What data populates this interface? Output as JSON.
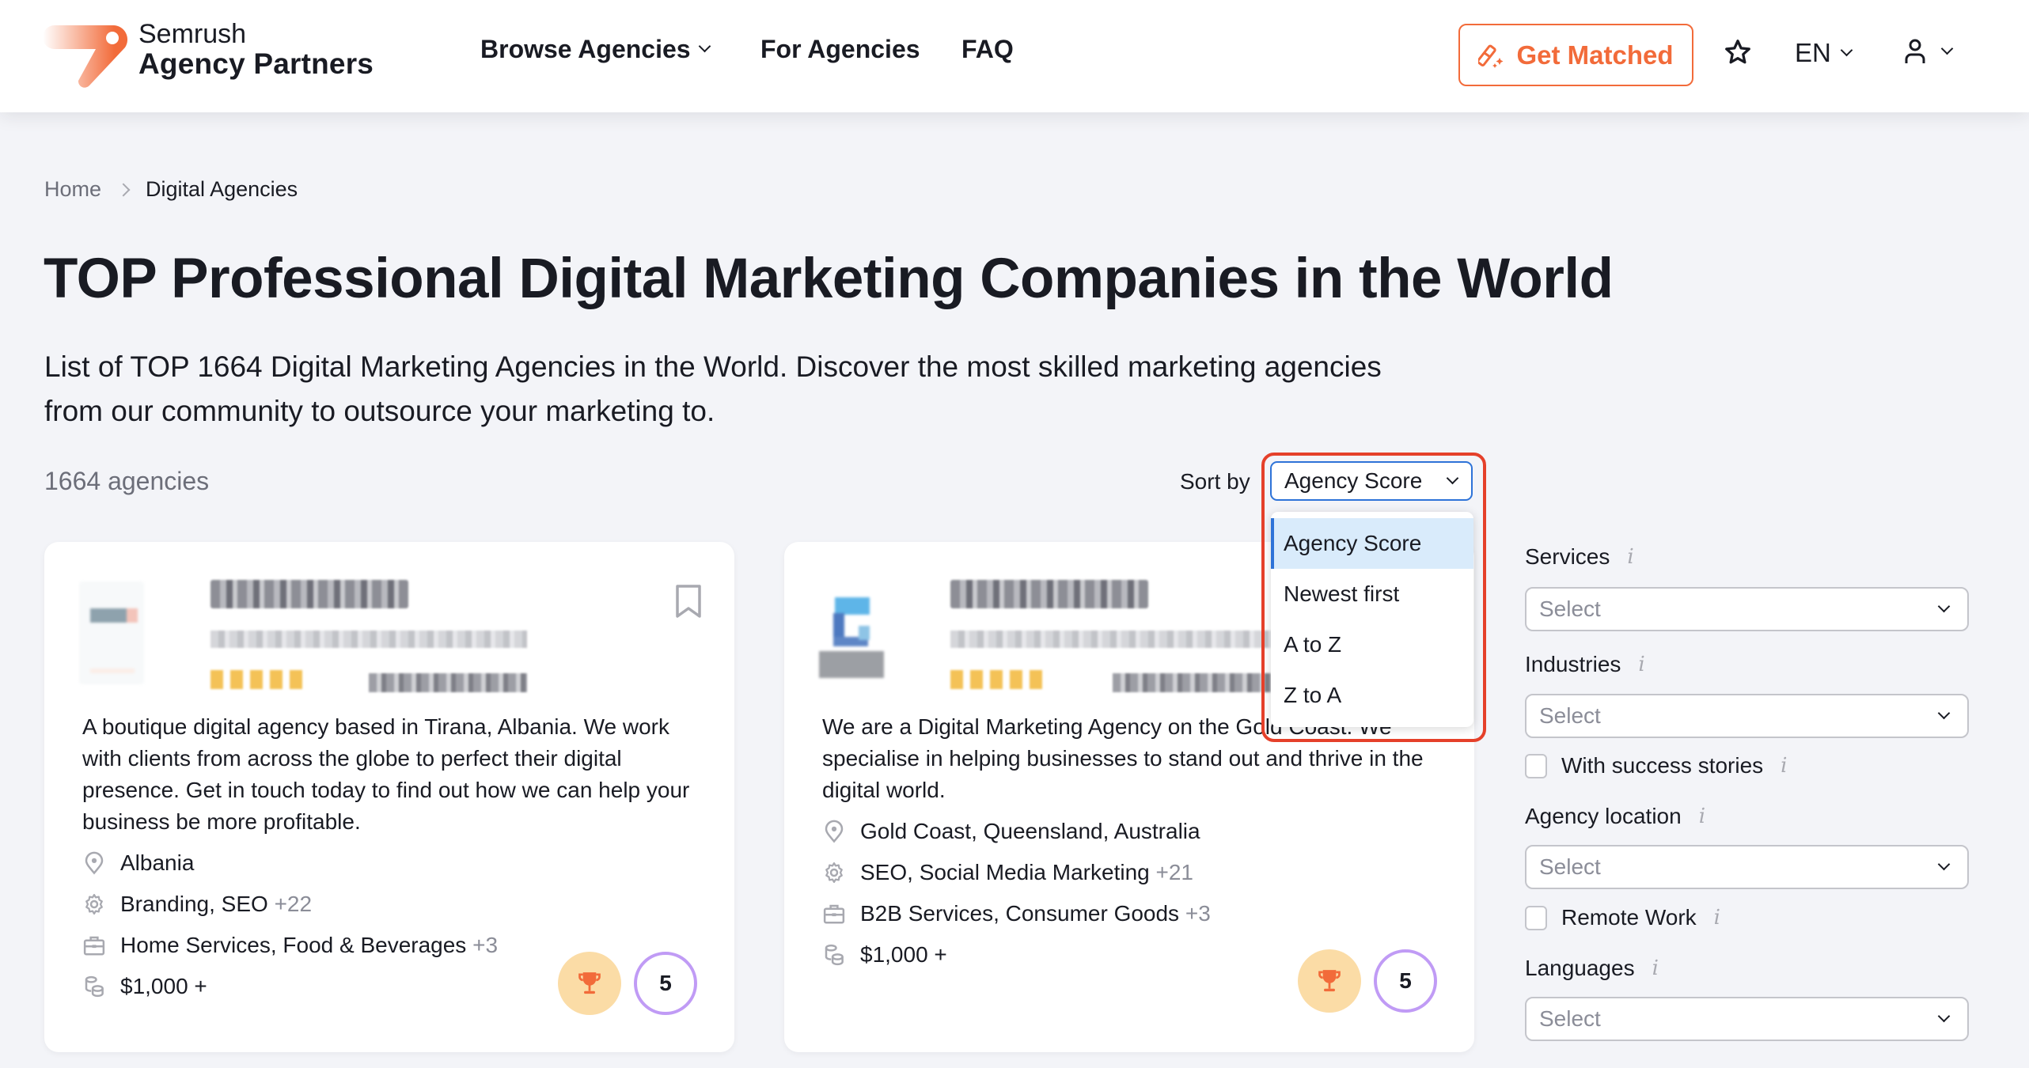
{
  "header": {
    "brand_top": "Semrush",
    "brand_bottom": "Agency Partners",
    "nav": [
      {
        "label": "Browse Agencies",
        "has_dropdown": true
      },
      {
        "label": "For Agencies",
        "has_dropdown": false
      },
      {
        "label": "FAQ",
        "has_dropdown": false
      }
    ],
    "get_matched_label": "Get Matched",
    "language": "EN",
    "accent_color": "#f26b3a"
  },
  "breadcrumb": {
    "home": "Home",
    "current": "Digital Agencies"
  },
  "page_title": "TOP Professional Digital Marketing Companies in the World",
  "intro": "List of TOP 1664 Digital Marketing Agencies in the World. Discover the most skilled marketing agencies from our community to outsource your marketing to.",
  "results_count": "1664 agencies",
  "sort": {
    "label": "Sort by",
    "selected": "Agency Score",
    "options": [
      "Agency Score",
      "Newest first",
      "A to Z",
      "Z to A"
    ],
    "highlight_color": "#e5402a"
  },
  "cards": [
    {
      "name_blurred": true,
      "description": "A boutique digital agency based in Tirana, Albania. We work with clients from across the globe to perfect their digital presence. Get in touch today to find out how we can help your business be more profitable.",
      "location": "Albania",
      "services": "Branding, SEO",
      "services_more": "+22",
      "industries": "Home Services, Food & Beverages",
      "industries_more": "+3",
      "budget": "$1,000 +",
      "score": "5"
    },
    {
      "name_blurred": true,
      "description": "We are a Digital Marketing Agency on the Gold Coast. We specialise in helping businesses to stand out and thrive in the digital world.",
      "location": "Gold Coast, Queensland, Australia",
      "services": "SEO, Social Media Marketing",
      "services_more": "+21",
      "industries": "B2B Services, Consumer Goods",
      "industries_more": "+3",
      "budget": "$1,000 +",
      "score": "5"
    }
  ],
  "filters": {
    "services": {
      "label": "Services",
      "placeholder": "Select"
    },
    "industries": {
      "label": "Industries",
      "placeholder": "Select"
    },
    "success_stories": {
      "label": "With success stories",
      "checked": false
    },
    "location": {
      "label": "Agency location",
      "placeholder": "Select"
    },
    "remote": {
      "label": "Remote Work",
      "checked": false
    },
    "languages": {
      "label": "Languages",
      "placeholder": "Select"
    },
    "info_glyph": "i"
  }
}
